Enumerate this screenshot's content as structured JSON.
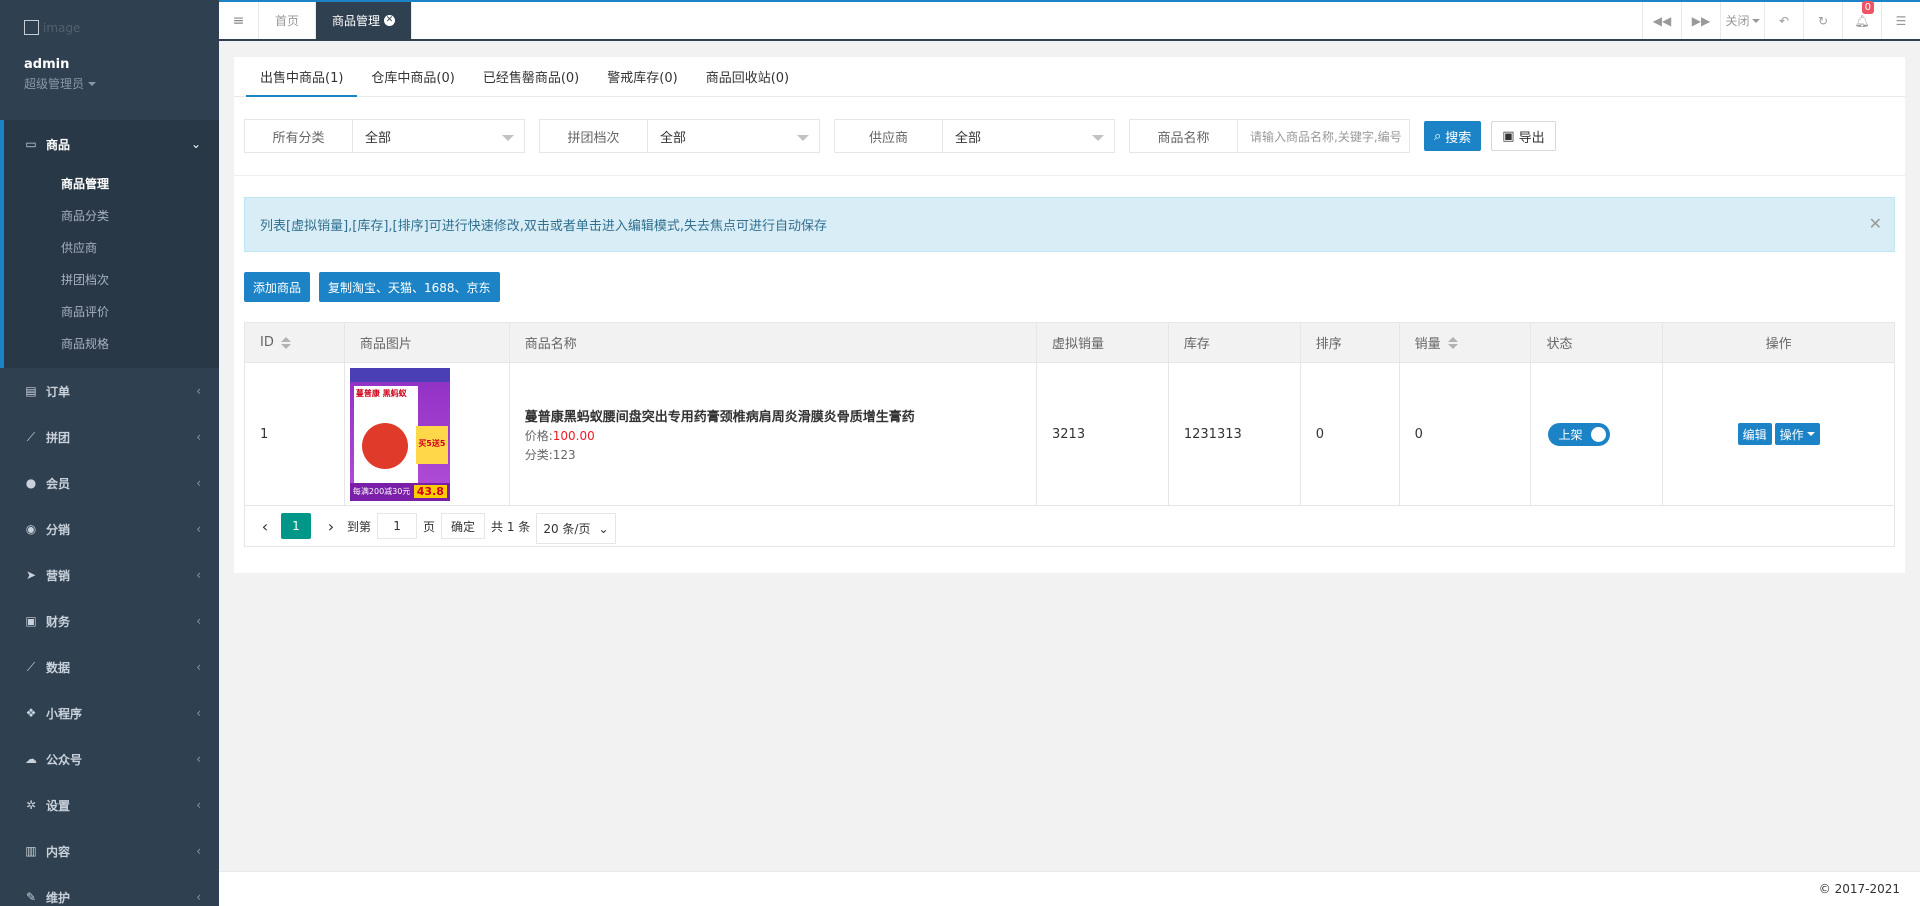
{
  "sidebar": {
    "logo_text": "image",
    "user_name": "admin",
    "user_role": "超级管理员",
    "menus": [
      {
        "label": "商品",
        "icon": "laptop-icon",
        "glyph": "▭",
        "expanded": true,
        "children": [
          "商品管理",
          "商品分类",
          "供应商",
          "拼团档次",
          "商品评价",
          "商品规格"
        ]
      },
      {
        "label": "订单",
        "icon": "file-icon",
        "glyph": "▤"
      },
      {
        "label": "拼团",
        "icon": "chart-icon",
        "glyph": "⟋"
      },
      {
        "label": "会员",
        "icon": "user-icon",
        "glyph": "●"
      },
      {
        "label": "分销",
        "icon": "users-icon",
        "glyph": "◉"
      },
      {
        "label": "营销",
        "icon": "send-icon",
        "glyph": "➤"
      },
      {
        "label": "财务",
        "icon": "money-icon",
        "glyph": "▣"
      },
      {
        "label": "数据",
        "icon": "line-chart-icon",
        "glyph": "⟋"
      },
      {
        "label": "小程序",
        "icon": "cubes-icon",
        "glyph": "❖"
      },
      {
        "label": "公众号",
        "icon": "wechat-icon",
        "glyph": "☁"
      },
      {
        "label": "设置",
        "icon": "gear-icon",
        "glyph": "✲"
      },
      {
        "label": "内容",
        "icon": "book-icon",
        "glyph": "▥"
      },
      {
        "label": "维护",
        "icon": "wrench-icon",
        "glyph": "✎"
      }
    ]
  },
  "topbar": {
    "tabs": [
      "首页",
      "商品管理"
    ],
    "close_label": "关闭",
    "notification_count": "0"
  },
  "main": {
    "tabs": [
      "出售中商品(1)",
      "仓库中商品(0)",
      "已经售罄商品(0)",
      "警戒库存(0)",
      "商品回收站(0)"
    ],
    "filters": {
      "category_label": "所有分类",
      "category_value": "全部",
      "group_label": "拼团档次",
      "group_value": "全部",
      "supplier_label": "供应商",
      "supplier_value": "全部",
      "name_label": "商品名称",
      "name_placeholder": "请输入商品名称,关键字,编号",
      "search_label": "搜索",
      "export_label": "导出"
    },
    "alert_text": "列表[虚拟销量],[库存],[排序]可进行快速修改,双击或者单击进入编辑模式,失去焦点可进行自动保存",
    "add_label": "添加商品",
    "copy_label": "复制淘宝、天猫、1688、京东",
    "table": {
      "headers": [
        "ID",
        "商品图片",
        "商品名称",
        "虚拟销量",
        "库存",
        "排序",
        "销量",
        "状态",
        "操作"
      ],
      "rows": [
        {
          "id": "1",
          "image_text": {
            "header": "蔓普康 黑蚂蚁",
            "sticker": "买5送5",
            "bottom": "每满200减30元",
            "price": "43.8"
          },
          "name": "蔓普康黑蚂蚁腰间盘突出专用药膏颈椎病肩周炎滑膜炎骨质增生膏药",
          "price_label": "价格:",
          "price": "100.00",
          "category": "分类:123",
          "virtual_sales": "3213",
          "stock": "1231313",
          "sort": "0",
          "sales": "0",
          "status": "上架",
          "edit_label": "编辑",
          "op_label": "操作"
        }
      ]
    },
    "pagination": {
      "current": "1",
      "goto_label": "到第",
      "goto_value": "1",
      "page_label": "页",
      "confirm_label": "确定",
      "total_label": "共 1 条",
      "page_size": "20 条/页"
    }
  },
  "footer": {
    "copyright": "© 2017-2021"
  },
  "colors": {
    "sidebar_bg": "#2f4050",
    "accent": "#1c84c6",
    "pager_active": "#009688"
  }
}
